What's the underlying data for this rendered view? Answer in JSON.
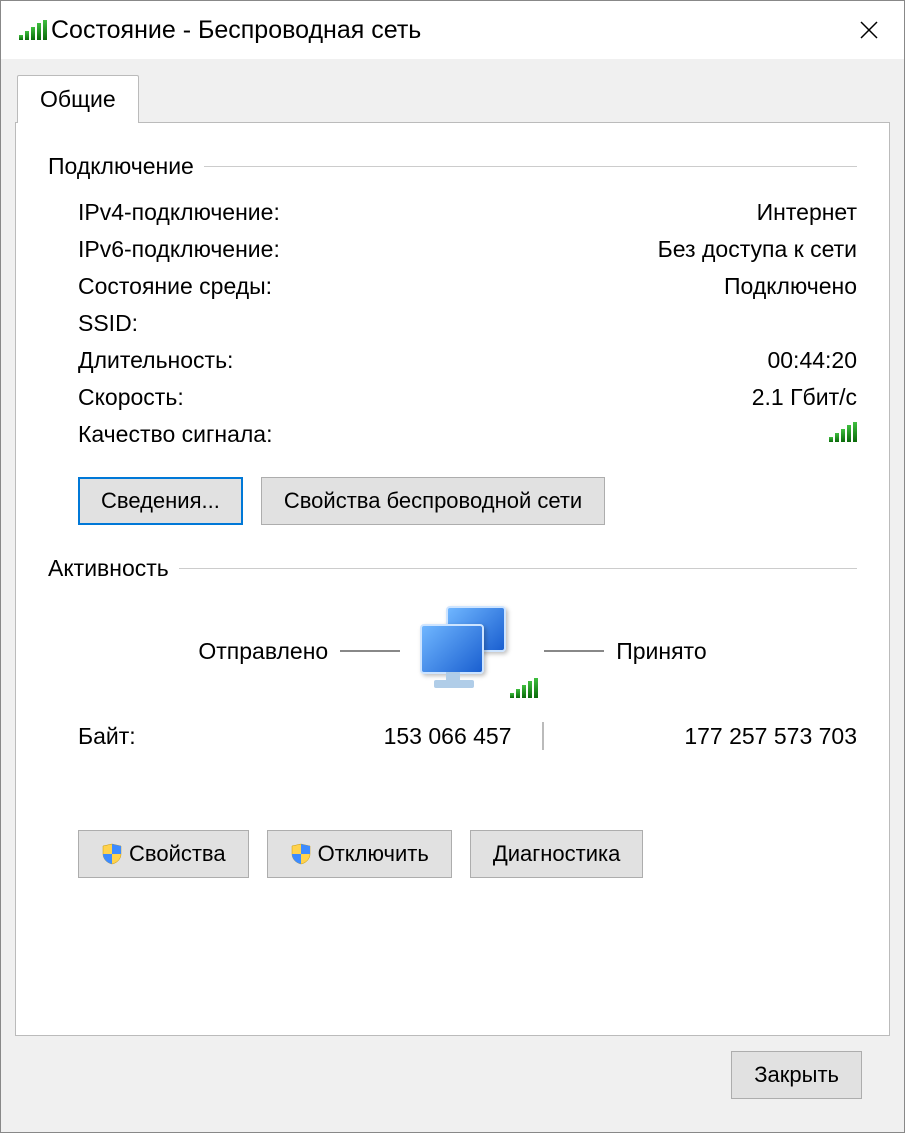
{
  "window": {
    "title": "Состояние - Беспроводная сеть"
  },
  "tab": {
    "label": "Общие"
  },
  "connection": {
    "group_label": "Подключение",
    "ipv4_label": "IPv4-подключение:",
    "ipv4_value": "Интернет",
    "ipv6_label": "IPv6-подключение:",
    "ipv6_value": "Без доступа к сети",
    "media_label": "Состояние среды:",
    "media_value": "Подключено",
    "ssid_label": "SSID:",
    "duration_label": "Длительность:",
    "duration_value": "00:44:20",
    "speed_label": "Скорость:",
    "speed_value": "2.1 Гбит/с",
    "signal_label": "Качество сигнала:"
  },
  "buttons": {
    "details": "Сведения...",
    "wireless_props": "Свойства беспроводной сети",
    "properties": "Свойства",
    "disable": "Отключить",
    "diagnose": "Диагностика",
    "close": "Закрыть"
  },
  "activity": {
    "group_label": "Активность",
    "sent_label": "Отправлено",
    "received_label": "Принято",
    "bytes_label": "Байт:",
    "bytes_sent": "153 066 457",
    "bytes_received": "177 257 573 703"
  }
}
